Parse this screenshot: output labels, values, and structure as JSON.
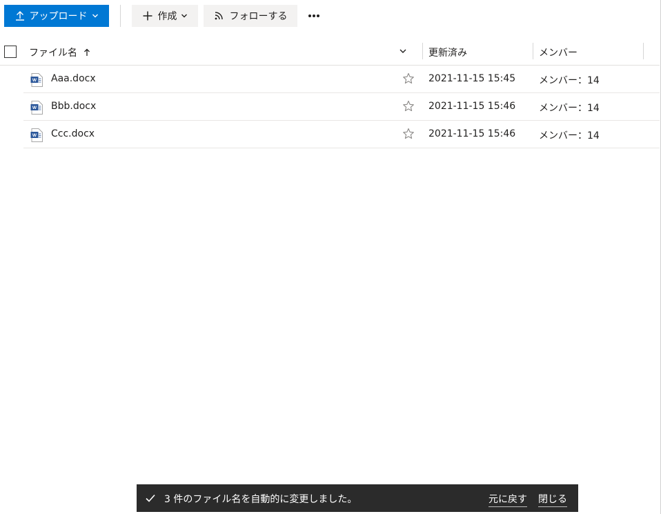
{
  "colors": {
    "primary": "#0078d4",
    "toast_bg": "#2b2b2b",
    "word_blue": "#2b579a"
  },
  "toolbar": {
    "upload_label": "アップロード",
    "create_label": "作成",
    "follow_label": "フォローする",
    "upload_icon": "upload-arrow-icon",
    "create_icon": "plus-icon",
    "follow_icon": "rss-icon",
    "more_icon": "more-dots-icon"
  },
  "list": {
    "columns": {
      "name": "ファイル名",
      "modified": "更新済み",
      "modified_by": "メンバー"
    },
    "sort": "ascending",
    "rows": [
      {
        "name": "Aaa.docx",
        "modified": "2021-11-15 15:45",
        "modified_by": "メンバー：14",
        "icon": "word-doc-icon"
      },
      {
        "name": "Bbb.docx",
        "modified": "2021-11-15 15:46",
        "modified_by": "メンバー：14",
        "icon": "word-doc-icon"
      },
      {
        "name": "Ccc.docx",
        "modified": "2021-11-15 15:46",
        "modified_by": "メンバー：14",
        "icon": "word-doc-icon"
      }
    ]
  },
  "toast": {
    "message": "3 件のファイル名を自動的に変更しました。",
    "undo": "元に戻す",
    "close": "閉じる"
  }
}
